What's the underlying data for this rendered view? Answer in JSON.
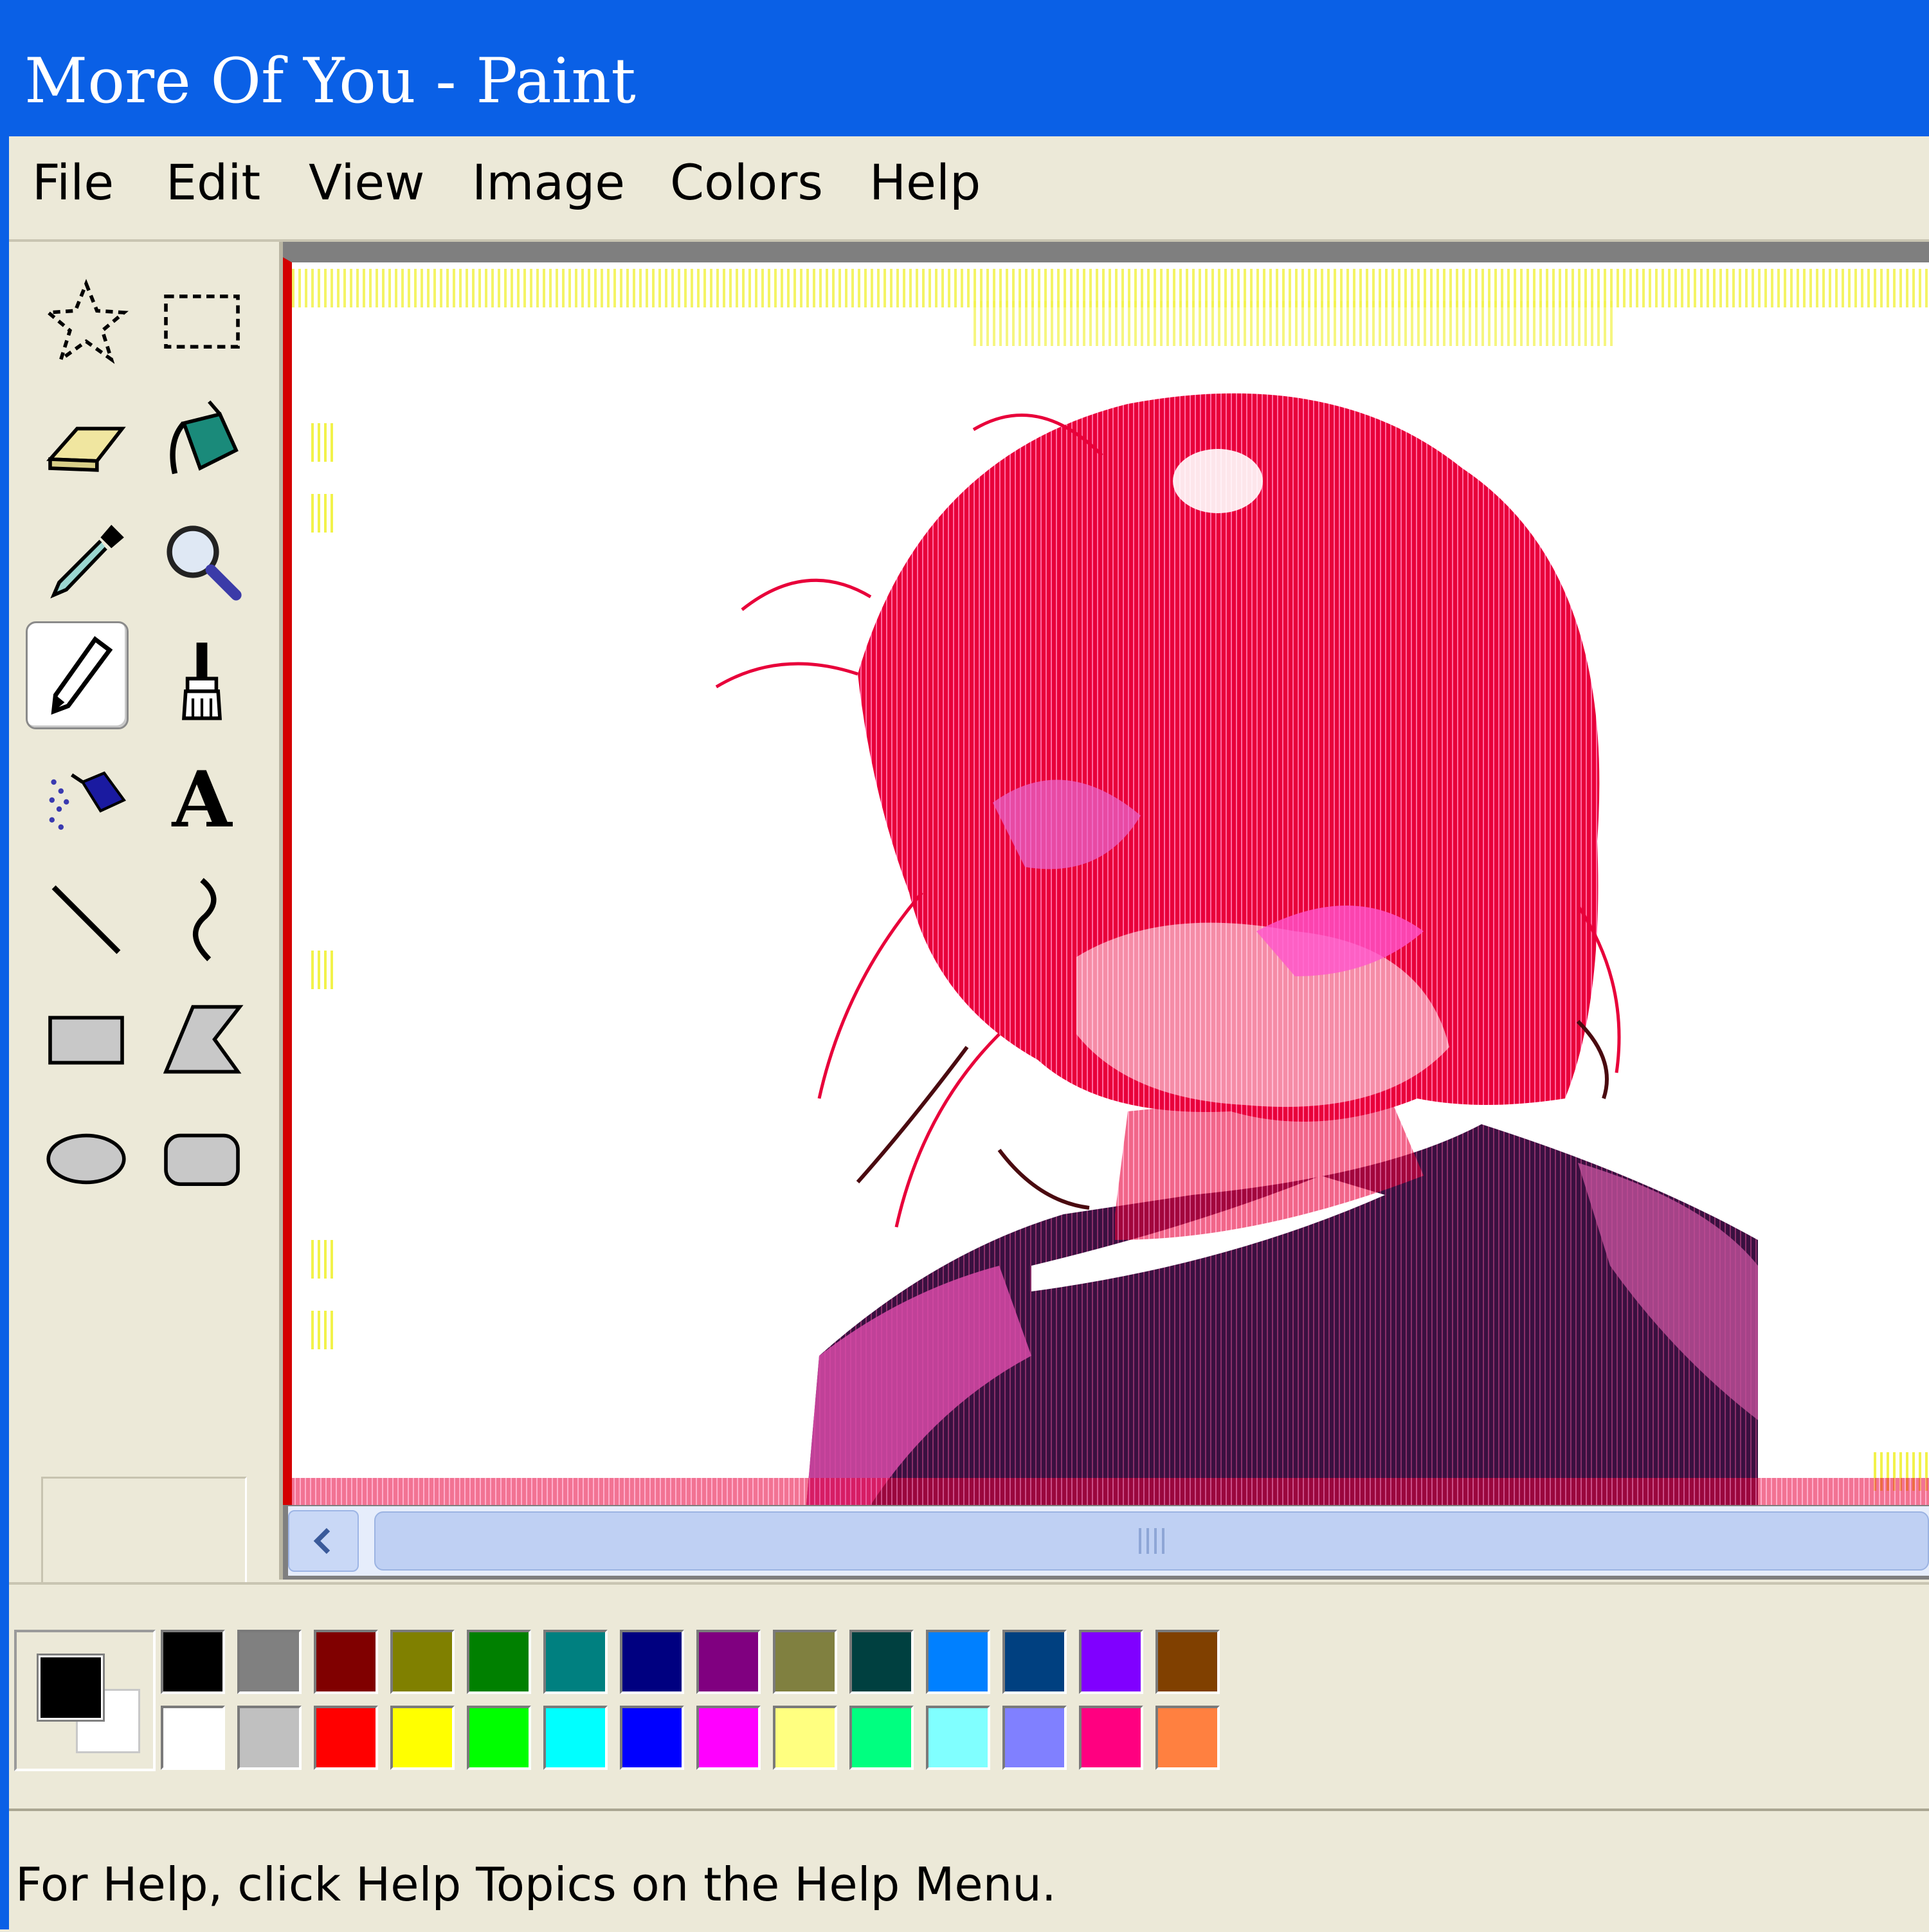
{
  "window": {
    "title": "More Of You - Paint"
  },
  "menu": [
    "File",
    "Edit",
    "View",
    "Image",
    "Colors",
    "Help"
  ],
  "tools": [
    {
      "icon": "free-form-select-icon"
    },
    {
      "icon": "rectangle-select-icon"
    },
    {
      "icon": "eraser-icon"
    },
    {
      "icon": "fill-bucket-icon"
    },
    {
      "icon": "color-picker-icon"
    },
    {
      "icon": "magnifier-icon"
    },
    {
      "icon": "pencil-icon",
      "active": true
    },
    {
      "icon": "brush-icon"
    },
    {
      "icon": "airbrush-icon"
    },
    {
      "icon": "text-icon",
      "glyph": "A"
    },
    {
      "icon": "line-icon"
    },
    {
      "icon": "curve-icon"
    },
    {
      "icon": "rectangle-icon"
    },
    {
      "icon": "polygon-icon"
    },
    {
      "icon": "ellipse-icon"
    },
    {
      "icon": "rounded-rectangle-icon"
    }
  ],
  "colors": {
    "foreground": "#000000",
    "background": "#ffffff",
    "palette_top": [
      "#000000",
      "#808080",
      "#800000",
      "#808000",
      "#008000",
      "#008080",
      "#000080",
      "#800080",
      "#808040",
      "#004040",
      "#0080ff",
      "#004080",
      "#8000ff",
      "#804000"
    ],
    "palette_bottom": [
      "#ffffff",
      "#c0c0c0",
      "#ff0000",
      "#ffff00",
      "#00ff00",
      "#00ffff",
      "#0000ff",
      "#ff00ff",
      "#ffff80",
      "#00ff80",
      "#80ffff",
      "#8080ff",
      "#ff0080",
      "#ff8040"
    ]
  },
  "status": {
    "text": "For Help, click Help Topics on the Help Menu."
  }
}
